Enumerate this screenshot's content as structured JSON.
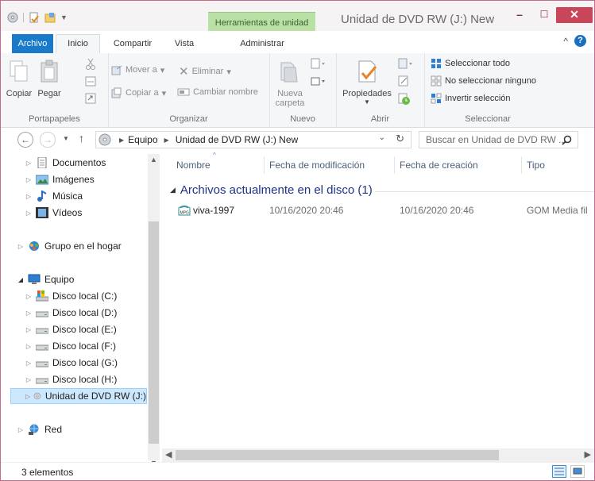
{
  "window": {
    "title": "Unidad de DVD RW (J:) New",
    "context_tab": "Herramientas de unidad",
    "controls": {
      "minimize": "–",
      "maximize": "☐",
      "close": "✕"
    },
    "accent": "#1979ca",
    "close_color": "#c8455a"
  },
  "ribbon_tabs": [
    "Archivo",
    "Inicio",
    "Compartir",
    "Vista",
    "Administrar"
  ],
  "help": {
    "collapse": "^",
    "icon": "help-icon",
    "help_label": "?"
  },
  "ribbon": {
    "groups": {
      "portapapeles": "Portapapeles",
      "organizar": "Organizar",
      "nuevo": "Nuevo",
      "abrir": "Abrir",
      "seleccionar": "Seleccionar"
    },
    "buttons": {
      "copiar": "Copiar",
      "pegar": "Pegar",
      "mover_a": "Mover a",
      "copiar_a": "Copiar a",
      "eliminar": "Eliminar",
      "cambiar_nombre": "Cambiar nombre",
      "nueva_carpeta": "Nueva carpeta",
      "propiedades": "Propiedades",
      "seleccionar_todo": "Seleccionar todo",
      "no_seleccionar": "No seleccionar ninguno",
      "invertir": "Invertir selección"
    }
  },
  "address": {
    "crumbs": [
      "Equipo",
      "Unidad de DVD RW (J:) New"
    ],
    "search_placeholder": "Buscar en Unidad de DVD RW ..."
  },
  "nav": {
    "items": [
      {
        "label": "Documentos",
        "icon": "documents-icon"
      },
      {
        "label": "Imágenes",
        "icon": "pictures-icon"
      },
      {
        "label": "Música",
        "icon": "music-icon"
      },
      {
        "label": "Vídeos",
        "icon": "videos-icon"
      },
      {
        "label": "Grupo en el hogar",
        "icon": "homegroup-icon"
      },
      {
        "label": "Equipo",
        "icon": "computer-icon"
      },
      {
        "label": "Disco local (C:)",
        "icon": "drive-c-icon"
      },
      {
        "label": "Disco local (D:)",
        "icon": "drive-icon"
      },
      {
        "label": "Disco local (E:)",
        "icon": "drive-icon"
      },
      {
        "label": "Disco local (F:)",
        "icon": "drive-icon"
      },
      {
        "label": "Disco local (G:)",
        "icon": "drive-icon"
      },
      {
        "label": "Disco local (H:)",
        "icon": "drive-icon"
      },
      {
        "label": "Unidad de DVD RW (J:)",
        "icon": "dvd-drive-icon"
      },
      {
        "label": "Red",
        "icon": "network-icon"
      }
    ]
  },
  "content": {
    "columns": [
      "Nombre",
      "Fecha de modificación",
      "Fecha de creación",
      "Tipo"
    ],
    "group_label": "Archivos actualmente en el disco (1)",
    "files": [
      {
        "name": "viva-1997",
        "modified": "10/16/2020 20:46",
        "created": "10/16/2020 20:46",
        "type": "GOM Media fil"
      }
    ]
  },
  "status": {
    "count": "3 elementos"
  }
}
